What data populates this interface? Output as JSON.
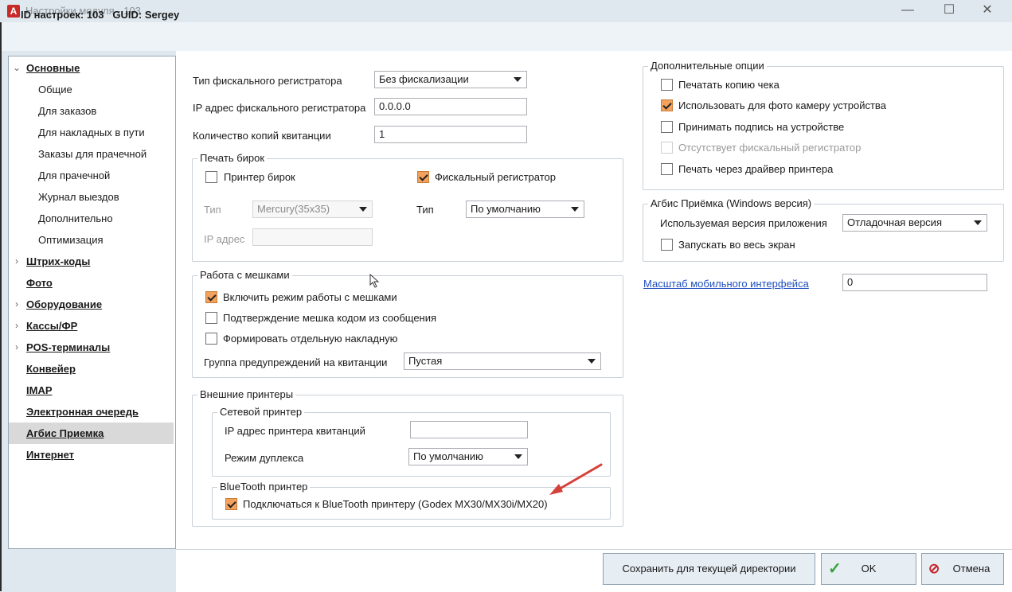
{
  "window": {
    "title": "Настройки модуля  - 103",
    "app_icon": "A",
    "minimize_glyph": "—",
    "maximize_glyph": "☐",
    "close_glyph": "✕"
  },
  "header": {
    "text": "ID настроек: 103   GUID: Sergey"
  },
  "nav": {
    "items": [
      {
        "label": "Основные",
        "chevron": "⌄"
      },
      {
        "label": "Общие"
      },
      {
        "label": "Для заказов"
      },
      {
        "label": "Для накладных в пути"
      },
      {
        "label": "Заказы для прачечной"
      },
      {
        "label": "Для прачечной"
      },
      {
        "label": "Журнал выездов"
      },
      {
        "label": "Дополнительно"
      },
      {
        "label": "Оптимизация"
      },
      {
        "label": "Штрих-коды",
        "chevron": "›"
      },
      {
        "label": "Фото"
      },
      {
        "label": "Оборудование",
        "chevron": "›"
      },
      {
        "label": "Кассы/ФР",
        "chevron": "›"
      },
      {
        "label": "POS-терминалы",
        "chevron": "›"
      },
      {
        "label": "Конвейер"
      },
      {
        "label": "IMAP"
      },
      {
        "label": "Электронная очередь"
      },
      {
        "label": "Агбис Приемка"
      },
      {
        "label": "Интернет"
      }
    ]
  },
  "fiscal": {
    "type_label": "Тип фискального регистратора",
    "type_value": "Без фискализации",
    "ip_label": "IP адрес фискального регистратора",
    "ip_value": "0.0.0.0",
    "copies_label": "Количество копий квитанции",
    "copies_value": "1"
  },
  "tags": {
    "title": "Печать бирок",
    "tag_printer_label": "Принтер бирок",
    "fiscal_reg_label": "Фискальный регистратор",
    "type_label": "Тип",
    "type_value": "Mercury(35x35)",
    "ip_label": "IP адрес",
    "type2_label": "Тип",
    "type2_value": "По умолчанию"
  },
  "bags": {
    "title": "Работа с мешками",
    "enable_label": "Включить режим работы с мешками",
    "confirm_label": "Подтверждение мешка кодом из сообщения",
    "separate_label": "Формировать отдельную накладную",
    "warn_label": "Группа предупреждений на квитанции",
    "warn_value": "Пустая"
  },
  "ext_printers": {
    "title": "Внешние принтеры",
    "net_title": "Сетевой принтер",
    "ip_label": "IP адрес принтера квитанций",
    "ip_value": "",
    "duplex_label": "Режим дуплекса",
    "duplex_value": "По умолчанию",
    "bt_title": "BlueTooth принтер",
    "bt_label": "Подключаться к BlueTooth принтеру (Godex MX30/MX30i/MX20)"
  },
  "extra": {
    "title": "Дополнительные опции",
    "print_copy": "Печатать копию чека",
    "use_camera": "Использовать для фото камеру устройства",
    "accept_sign": "Принимать подпись на устройстве",
    "no_fiscal": "Отсутствует фискальный регистратор",
    "print_driver": "Печать через драйвер принтера"
  },
  "agbis": {
    "title": "Агбис Приёмка (Windows версия)",
    "version_label": "Используемая версия приложения",
    "version_value": "Отладочная версия",
    "fullscreen_label": "Запускать во весь экран"
  },
  "scale": {
    "label": "Масштаб мобильного интерфейса",
    "value": "0"
  },
  "buttons": {
    "save_dir": "Сохранить для текущей директории",
    "ok": "OK",
    "cancel": "Отмена",
    "ok_icon": "✓",
    "cancel_icon": "⊘"
  },
  "colors": {
    "checkbox_checked": "#f2a25c",
    "link": "#1f4fbf",
    "selected_nav": "#d9d9d9",
    "annotation_arrow": "#d6403a"
  }
}
